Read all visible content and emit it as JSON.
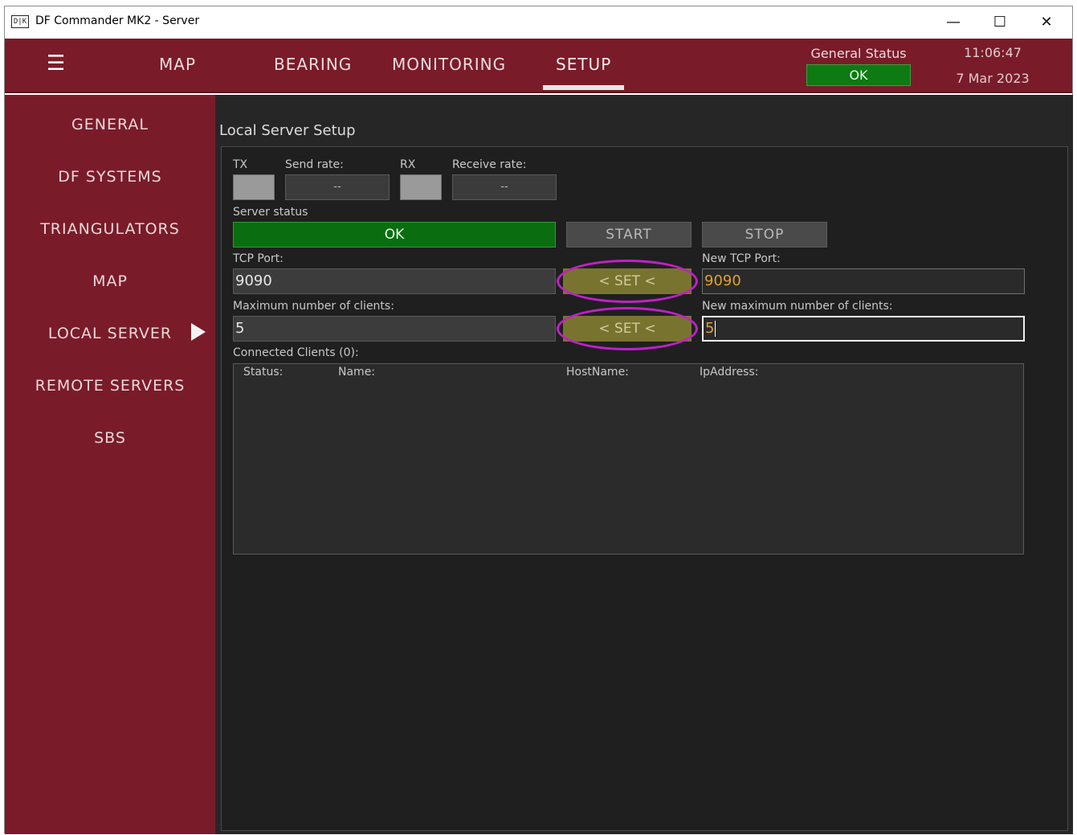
{
  "window": {
    "title": "DF Commander MK2 - Server",
    "app_icon": "df-commander-logo-icon",
    "app_icon_text": "D|K",
    "controls": {
      "minimize": "—",
      "maximize": "☐",
      "close": "✕"
    }
  },
  "header": {
    "menu_icon": "☰",
    "tabs": [
      {
        "label": "MAP"
      },
      {
        "label": "BEARING"
      },
      {
        "label": "MONITORING"
      },
      {
        "label": "SETUP",
        "active": true
      }
    ],
    "general_status": {
      "label": "General Status",
      "value": "OK",
      "color": "#0d7a12"
    },
    "clock": {
      "time": "11:06:47",
      "date": "7 Mar 2023"
    },
    "brand_color": "#7a1b2a"
  },
  "sidebar": {
    "items": [
      {
        "label": "GENERAL"
      },
      {
        "label": "DF SYSTEMS"
      },
      {
        "label": "TRIANGULATORS"
      },
      {
        "label": "MAP"
      },
      {
        "label": "LOCAL SERVER",
        "active": true
      },
      {
        "label": "REMOTE SERVERS"
      },
      {
        "label": "SBS"
      }
    ]
  },
  "local_server": {
    "title": "Local Server Setup",
    "tx_label": "TX",
    "send_rate_label": "Send rate:",
    "send_rate_value": "--",
    "rx_label": "RX",
    "receive_rate_label": "Receive rate:",
    "receive_rate_value": "--",
    "server_status_label": "Server status",
    "server_status_value": "OK",
    "start_label": "START",
    "stop_label": "STOP",
    "tcp_port_label": "TCP Port:",
    "tcp_port_value": "9090",
    "set_label": "< SET <",
    "new_tcp_port_label": "New TCP Port:",
    "new_tcp_port_value": "9090",
    "max_clients_label": "Maximum number of clients:",
    "max_clients_value": "5",
    "new_max_clients_label": "New maximum number of clients:",
    "new_max_clients_value": "5",
    "connected_clients_label": "Connected Clients (0):",
    "columns": [
      "Status:",
      "Name:",
      "HostName:",
      "IpAddress:"
    ],
    "highlight_color": "#c020c8"
  }
}
